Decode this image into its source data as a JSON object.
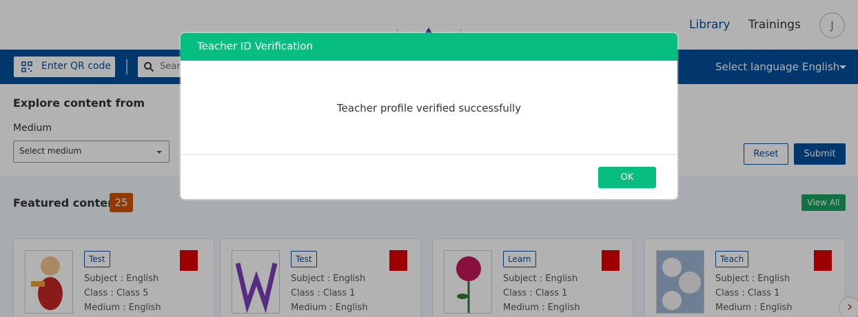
{
  "header": {
    "nav": {
      "library": "Library",
      "trainings": "Trainings"
    },
    "avatar_initial": "J"
  },
  "toolbar": {
    "qr_label": "Enter QR code",
    "search_placeholder": "Search",
    "language_label": "Select language :",
    "language_value": "English"
  },
  "explore": {
    "title": "Explore content from",
    "medium_label": "Medium",
    "medium_placeholder": "Select medium",
    "reset": "Reset",
    "submit": "Submit"
  },
  "featured": {
    "title": "Featured content",
    "count": "25",
    "view_all": "View All",
    "cards": [
      {
        "badge": "Test",
        "subject": "Subject : English",
        "class": "Class : Class 5",
        "medium": "Medium : English",
        "thumb": "cartoon-character"
      },
      {
        "badge": "Test",
        "subject": "Subject : English",
        "class": "Class : Class 1",
        "medium": "Medium : English",
        "thumb": "purple-logo"
      },
      {
        "badge": "Learn",
        "subject": "Subject : English",
        "class": "Class : Class 1",
        "medium": "Medium : English",
        "thumb": "red-rose"
      },
      {
        "badge": "Teach",
        "subject": "Subject : English",
        "class": "Class : Class 1",
        "medium": "Medium : English",
        "thumb": "cotton-flowers"
      }
    ]
  },
  "modal": {
    "title": "Teacher ID Verification",
    "message": "Teacher profile verified successfully",
    "ok": "OK"
  },
  "colors": {
    "brand_blue": "#024f9d",
    "modal_green": "#08bd80",
    "count_orange": "#d35400",
    "view_all_green": "#1aa35f",
    "red_square": "#e00000"
  }
}
